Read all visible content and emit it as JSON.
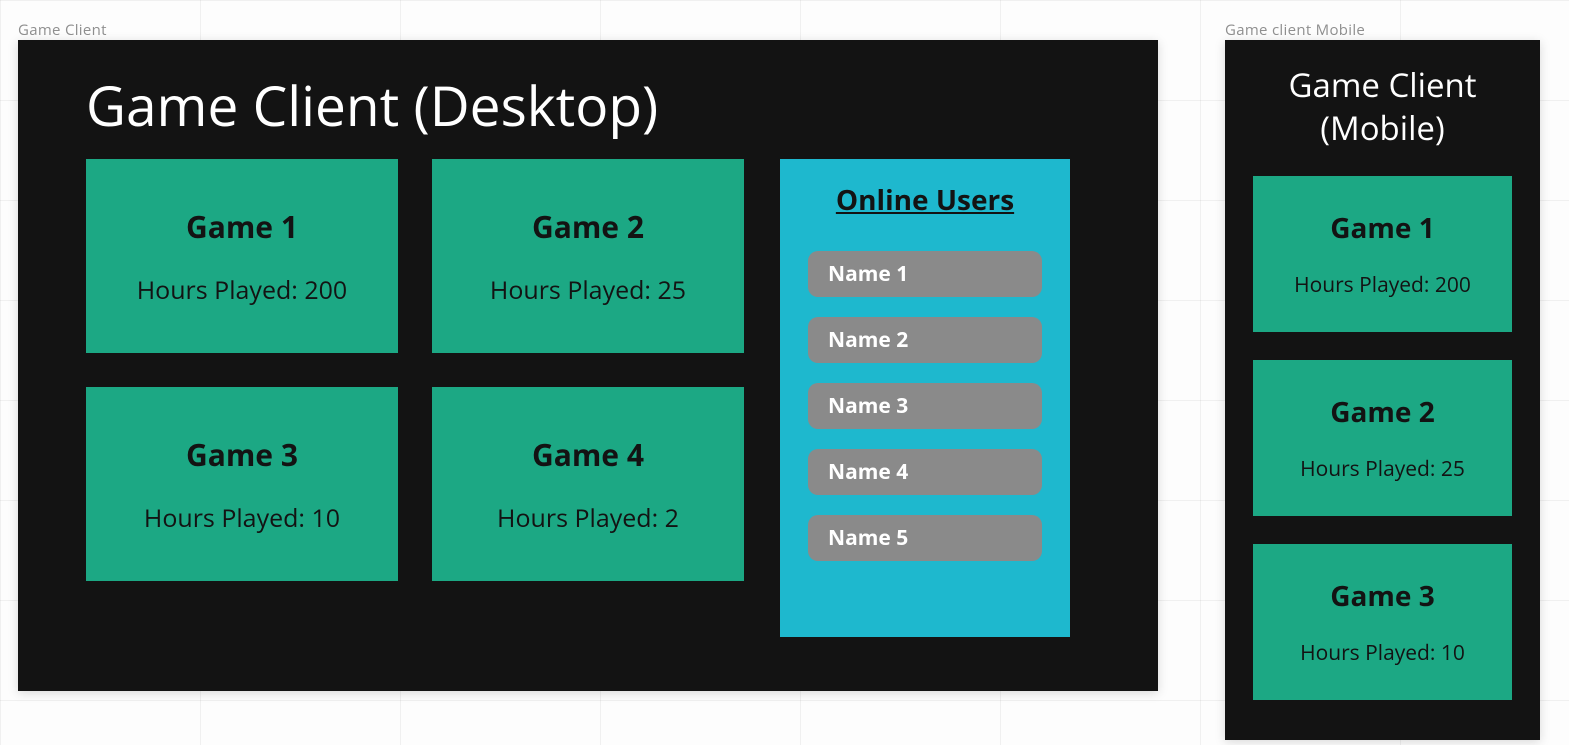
{
  "frame_labels": {
    "desktop": "Game Client",
    "mobile": "Game client Mobile"
  },
  "desktop": {
    "title": "Game Client (Desktop)",
    "games": [
      {
        "name": "Game 1",
        "hours": "Hours Played: 200"
      },
      {
        "name": "Game 2",
        "hours": "Hours Played: 25"
      },
      {
        "name": "Game 3",
        "hours": "Hours Played: 10"
      },
      {
        "name": "Game 4",
        "hours": "Hours Played: 2"
      }
    ],
    "online_title": "Online Users",
    "online_users": [
      "Name 1",
      "Name 2",
      "Name 3",
      "Name 4",
      "Name 5"
    ]
  },
  "mobile": {
    "title": "Game Client (Mobile)",
    "games": [
      {
        "name": "Game 1",
        "hours": "Hours Played: 200"
      },
      {
        "name": "Game 2",
        "hours": "Hours Played: 25"
      },
      {
        "name": "Game 3",
        "hours": "Hours Played: 10"
      }
    ]
  }
}
